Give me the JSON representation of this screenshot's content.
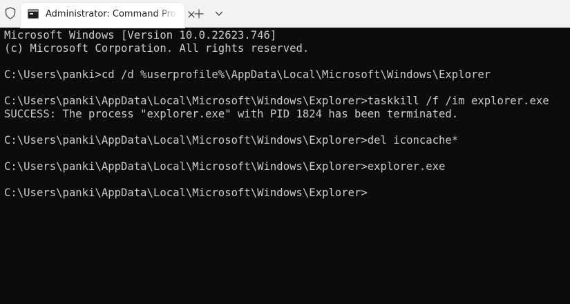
{
  "tabbar": {
    "tab_title": "Administrator: Command Prompt",
    "new_tab_label": "+",
    "icons": {
      "shield": "shield-icon",
      "tab": "cmd-terminal-icon",
      "close": "close-icon",
      "dropdown": "chevron-down-icon"
    }
  },
  "console": {
    "lines": [
      "Microsoft Windows [Version 10.0.22623.746]",
      "(c) Microsoft Corporation. All rights reserved.",
      "",
      "C:\\Users\\panki>cd /d %userprofile%\\AppData\\Local\\Microsoft\\Windows\\Explorer",
      "",
      "C:\\Users\\panki\\AppData\\Local\\Microsoft\\Windows\\Explorer>taskkill /f /im explorer.exe",
      "SUCCESS: The process \"explorer.exe\" with PID 1824 has been terminated.",
      "",
      "C:\\Users\\panki\\AppData\\Local\\Microsoft\\Windows\\Explorer>del iconcache*",
      "",
      "C:\\Users\\panki\\AppData\\Local\\Microsoft\\Windows\\Explorer>explorer.exe",
      "",
      "C:\\Users\\panki\\AppData\\Local\\Microsoft\\Windows\\Explorer>"
    ]
  },
  "colors": {
    "console_background": "#0c0c0c",
    "console_text": "#cccccc",
    "tabbar_background": "#f3f3f3",
    "active_tab_background": "#ffffff"
  }
}
